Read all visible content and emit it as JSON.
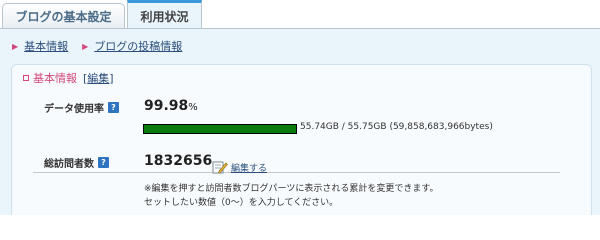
{
  "tabs": {
    "basic_settings": "ブログの基本設定",
    "usage": "利用状況"
  },
  "subnav": {
    "basic_info": "基本情報",
    "post_info": "ブログの投稿情報"
  },
  "section": {
    "title": "基本情報",
    "edit_open": "[",
    "edit_label": "編集",
    "edit_close": "]"
  },
  "data_usage": {
    "label": "データ使用率",
    "help": "?",
    "percent_value": "99.98",
    "percent_unit": "%",
    "usage_fraction": 0.9998,
    "caption": "55.74GB / 55.75GB (59,858,683,966bytes)"
  },
  "visitors": {
    "label": "総訪問者数",
    "help": "?",
    "value": "1832656",
    "edit_label": "編集する",
    "note_line1": "※編集を押すと訪問者数ブログパーツに表示される累計を変更できます。",
    "note_line2": "セットしたい数値（0〜）を入力してください。"
  },
  "colors": {
    "accent_pink": "#d2487d",
    "link_blue": "#2b4e7a",
    "bar_green": "#0a7a0a",
    "tab_active_border": "#3a9ad9"
  }
}
